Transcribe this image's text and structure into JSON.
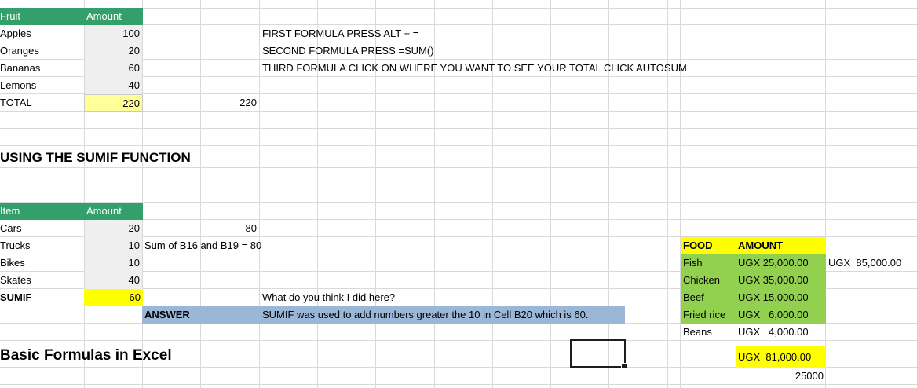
{
  "table1": {
    "header": {
      "col_a": "Fruit",
      "col_b": "Amount"
    },
    "rows": [
      {
        "name": "Apples",
        "value": "100"
      },
      {
        "name": "Oranges",
        "value": "20"
      },
      {
        "name": "Bananas",
        "value": "60"
      },
      {
        "name": "Lemons",
        "value": "40"
      }
    ],
    "total": {
      "label": "TOTAL",
      "value": "220",
      "extra": "220"
    }
  },
  "notes": {
    "first": "FIRST FORMULA PRESS ALT + =",
    "second": "SECOND FORMULA PRESS =SUM()",
    "third": "THIRD FORMULA CLICK ON WHERE YOU WANT TO SEE YOUR TOTAL CLICK AUTOSUM"
  },
  "sumif_title": "USING THE SUMIF FUNCTION",
  "table2": {
    "header": {
      "col_a": "Item",
      "col_b": "Amount"
    },
    "rows": [
      {
        "name": "Cars",
        "value": "20",
        "extra": "80"
      },
      {
        "name": "Trucks",
        "value": "10",
        "note": "Sum of B16 and B19 = 80"
      },
      {
        "name": "Bikes",
        "value": "10"
      },
      {
        "name": "Skates",
        "value": "40"
      }
    ],
    "sumif": {
      "label": "SUMIF",
      "value": "60"
    },
    "answer_label": "ANSWER",
    "question": "What do you think I did here?",
    "answer": "SUMIF was used to add numbers greater the 10 in Cell B20 which is 60."
  },
  "basic_title": "Basic Formulas in Excel",
  "food": {
    "header": {
      "col_a": "FOOD",
      "col_b": "AMOUNT"
    },
    "rows": [
      {
        "name": "Fish",
        "value": "UGX 25,000.00"
      },
      {
        "name": "Chicken",
        "value": "UGX 35,000.00"
      },
      {
        "name": "Beef",
        "value": "UGX 15,000.00"
      },
      {
        "name": "Fried rice",
        "value": "UGX   6,000.00"
      },
      {
        "name": "Beans",
        "value": "UGX   4,000.00"
      }
    ],
    "side_total": "UGX  85,000.00",
    "total": "UGX  81,000.00",
    "plain_total": "25000"
  },
  "colors": {
    "green_header": "#33a06b",
    "gray_fill": "#efefef",
    "yellow": "#ffff00",
    "light_yellow": "#ffff99",
    "green_fill": "#92d050",
    "blue_fill": "#9bb7d8"
  }
}
